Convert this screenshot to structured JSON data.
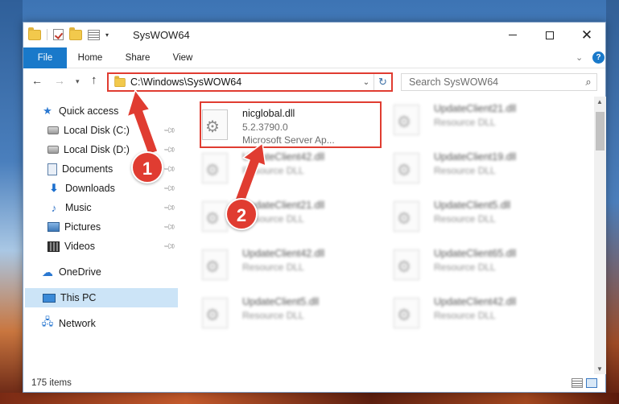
{
  "window": {
    "title": "SysWOW64"
  },
  "ribbon": {
    "tabs": [
      {
        "label": "File"
      },
      {
        "label": "Home"
      },
      {
        "label": "Share"
      },
      {
        "label": "View"
      }
    ],
    "help": "?"
  },
  "window_controls": {
    "close": "✕"
  },
  "nav": {
    "address": "C:\\Windows\\SysWOW64",
    "refresh_glyph": "↻",
    "search_placeholder": "Search SysWOW64"
  },
  "sidebar": {
    "items": [
      {
        "label": "Quick access",
        "icon": "star-icon"
      },
      {
        "label": "Local Disk (C:)",
        "icon": "drive-icon",
        "pinned": true
      },
      {
        "label": "Local Disk (D:)",
        "icon": "drive-icon",
        "pinned": true
      },
      {
        "label": "Documents",
        "icon": "documents-icon",
        "pinned": true
      },
      {
        "label": "Downloads",
        "icon": "download-icon",
        "pinned": true
      },
      {
        "label": "Music",
        "icon": "music-icon",
        "pinned": true
      },
      {
        "label": "Pictures",
        "icon": "pictures-icon",
        "pinned": true
      },
      {
        "label": "Videos",
        "icon": "videos-icon",
        "pinned": true
      },
      {
        "label": "OneDrive",
        "icon": "cloud-icon"
      },
      {
        "label": "This PC",
        "icon": "computer-icon",
        "selected": true
      },
      {
        "label": "Network",
        "icon": "network-icon"
      }
    ]
  },
  "files": [
    {
      "name": "nicglobal.dll",
      "version": "5.2.3790.0",
      "desc": "Microsoft Server Ap..."
    },
    {
      "name": "UpdateClient21.dll",
      "desc": "Resource DLL"
    },
    {
      "name": "UpdateClient42.dll",
      "desc": "Resource DLL"
    },
    {
      "name": "UpdateClient19.dll",
      "desc": "Resource DLL"
    },
    {
      "name": "UpdateClient21.dll",
      "desc": "Resource DLL"
    },
    {
      "name": "UpdateClient5.dll",
      "desc": "Resource DLL"
    },
    {
      "name": "UpdateClient42.dll",
      "desc": "Resource DLL"
    },
    {
      "name": "UpdateClient65.dll",
      "desc": "Resource DLL"
    },
    {
      "name": "UpdateClient5.dll",
      "desc": "Resource DLL"
    },
    {
      "name": "UpdateClient42.dll",
      "desc": "Resource DLL"
    }
  ],
  "status": {
    "items_count": "175 items"
  },
  "annotations": {
    "step1": "1",
    "step2": "2",
    "color": "#e03c31"
  }
}
